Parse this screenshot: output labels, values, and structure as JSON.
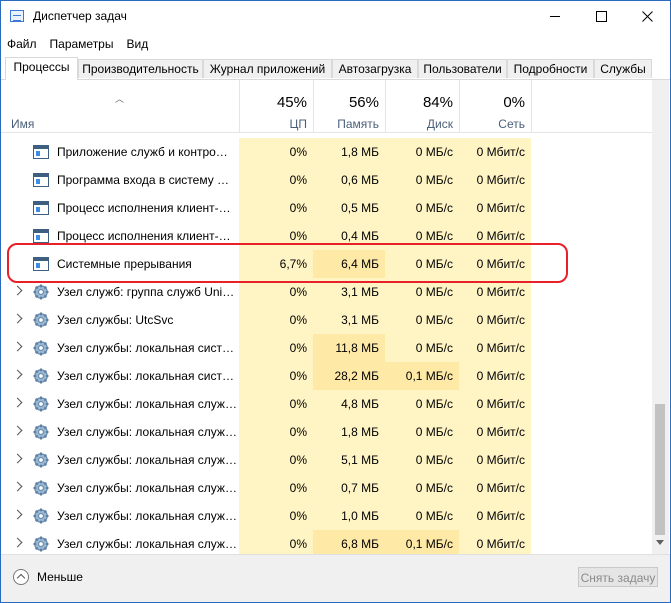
{
  "window": {
    "title": "Диспетчер задач"
  },
  "menu": [
    "Файл",
    "Параметры",
    "Вид"
  ],
  "tabs": [
    "Процессы",
    "Производительность",
    "Журнал приложений",
    "Автозагрузка",
    "Пользователи",
    "Подробности",
    "Службы"
  ],
  "active_tab": 0,
  "columns": {
    "name": {
      "label": "Имя"
    },
    "cpu": {
      "pct": "45%",
      "label": "ЦП"
    },
    "mem": {
      "pct": "56%",
      "label": "Память"
    },
    "disk": {
      "pct": "84%",
      "label": "Диск"
    },
    "net": {
      "pct": "0%",
      "label": "Сеть"
    }
  },
  "rows": [
    {
      "name": "Приложение служб и контро…",
      "cpu": "0%",
      "mem": "1,8 МБ",
      "disk": "0 МБ/с",
      "net": "0 Мбит/с",
      "icon": "window-app-icon",
      "expandable": false
    },
    {
      "name": "Программа входа в систему …",
      "cpu": "0%",
      "mem": "0,6 МБ",
      "disk": "0 МБ/с",
      "net": "0 Мбит/с",
      "icon": "window-app-icon",
      "expandable": false
    },
    {
      "name": "Процесс исполнения клиент-…",
      "cpu": "0%",
      "mem": "0,5 МБ",
      "disk": "0 МБ/с",
      "net": "0 Мбит/с",
      "icon": "window-app-icon",
      "expandable": false
    },
    {
      "name": "Процесс исполнения клиент-…",
      "cpu": "0%",
      "mem": "0,4 МБ",
      "disk": "0 МБ/с",
      "net": "0 Мбит/с",
      "icon": "window-app-icon",
      "expandable": false
    },
    {
      "name": "Системные прерывания",
      "cpu": "6,7%",
      "mem": "6,4 МБ",
      "disk": "0 МБ/с",
      "net": "0 Мбит/с",
      "icon": "window-app-icon",
      "expandable": false
    },
    {
      "name": "Узел служб: группа служб Uni…",
      "cpu": "0%",
      "mem": "3,1 МБ",
      "disk": "0 МБ/с",
      "net": "0 Мбит/с",
      "icon": "gear-icon",
      "expandable": true
    },
    {
      "name": "Узел службы: UtcSvc",
      "cpu": "0%",
      "mem": "3,1 МБ",
      "disk": "0 МБ/с",
      "net": "0 Мбит/с",
      "icon": "gear-icon",
      "expandable": true
    },
    {
      "name": "Узел службы: локальная сист…",
      "cpu": "0%",
      "mem": "11,8 МБ",
      "disk": "0 МБ/с",
      "net": "0 Мбит/с",
      "icon": "gear-icon",
      "expandable": true
    },
    {
      "name": "Узел службы: локальная сист…",
      "cpu": "0%",
      "mem": "28,2 МБ",
      "disk": "0,1 МБ/с",
      "net": "0 Мбит/с",
      "icon": "gear-icon",
      "expandable": true
    },
    {
      "name": "Узел службы: локальная служ…",
      "cpu": "0%",
      "mem": "4,8 МБ",
      "disk": "0 МБ/с",
      "net": "0 Мбит/с",
      "icon": "gear-icon",
      "expandable": true
    },
    {
      "name": "Узел службы: локальная служ…",
      "cpu": "0%",
      "mem": "1,8 МБ",
      "disk": "0 МБ/с",
      "net": "0 Мбит/с",
      "icon": "gear-icon",
      "expandable": true
    },
    {
      "name": "Узел службы: локальная служ…",
      "cpu": "0%",
      "mem": "5,1 МБ",
      "disk": "0 МБ/с",
      "net": "0 Мбит/с",
      "icon": "gear-icon",
      "expandable": true
    },
    {
      "name": "Узел службы: локальная служ…",
      "cpu": "0%",
      "mem": "0,7 МБ",
      "disk": "0 МБ/с",
      "net": "0 Мбит/с",
      "icon": "gear-icon",
      "expandable": true
    },
    {
      "name": "Узел службы: локальная служ…",
      "cpu": "0%",
      "mem": "1,0 МБ",
      "disk": "0 МБ/с",
      "net": "0 Мбит/с",
      "icon": "gear-icon",
      "expandable": true
    },
    {
      "name": "Узел службы: локальная служ…",
      "cpu": "0%",
      "mem": "6,8 МБ",
      "disk": "0,1 МБ/с",
      "net": "0 Мбит/с",
      "icon": "gear-icon",
      "expandable": true
    }
  ],
  "highlighted_row": 4,
  "footer": {
    "less_label": "Меньше",
    "end_task_label": "Снять задачу"
  },
  "colors": {
    "highlight_outline": "#e8202a",
    "usage_light": "#fff4c4",
    "usage_medium": "#ffe9a6"
  }
}
